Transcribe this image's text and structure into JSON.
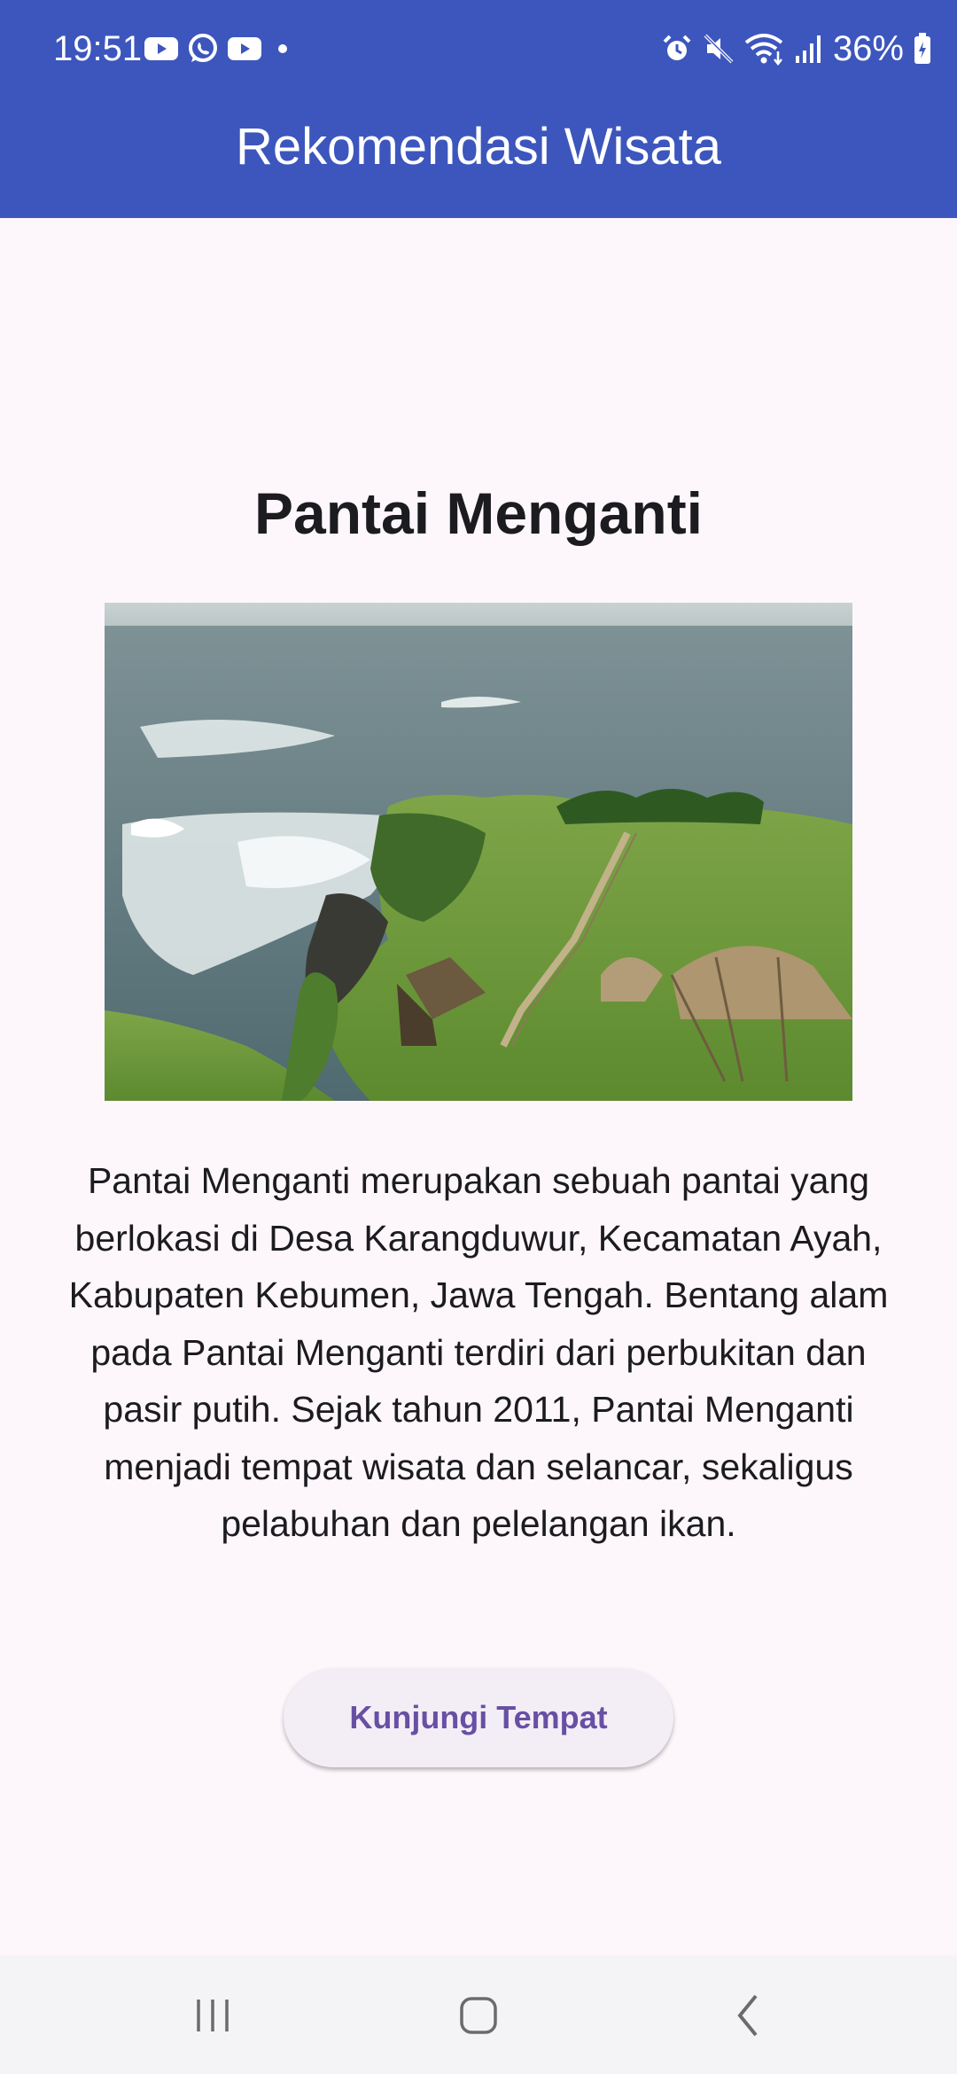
{
  "status_bar": {
    "time": "19:51",
    "battery": "36%",
    "left_icons": [
      "youtube-icon",
      "whatsapp-icon",
      "youtube-icon",
      "dot-icon"
    ],
    "right_icons": [
      "alarm-icon",
      "mute-icon",
      "wifi-icon",
      "signal-icon",
      "battery-icon"
    ]
  },
  "header": {
    "title": "Rekomendasi Wisata",
    "background": "#3d56bd"
  },
  "place": {
    "name": "Pantai Menganti",
    "image": "coastal-cliff-photo",
    "description": "Pantai Menganti merupakan sebuah pantai yang berlokasi di Desa Karangduwur, Kecamatan Ayah, Kabupaten Kebumen, Jawa Tengah. Bentang alam pada Pantai Menganti terdiri dari perbukitan dan pasir putih. Sejak tahun 2011, Pantai Menganti menjadi tempat wisata dan selancar, sekaligus pelabuhan dan pelelangan ikan."
  },
  "action": {
    "button_label": "Kunjungi Tempat",
    "accent": "#6750a4"
  },
  "nav": {
    "buttons": [
      "recents-icon",
      "home-icon",
      "back-icon"
    ]
  }
}
